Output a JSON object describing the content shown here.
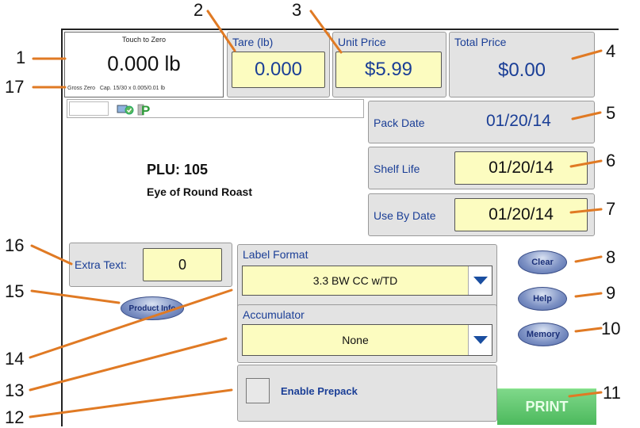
{
  "weight": {
    "caption": "Touch to Zero",
    "value": "0.000 lb",
    "status": "Gross Zero   Cap. 15/30 x 0.005/0.01 lb"
  },
  "tare": {
    "label": "Tare (lb)",
    "value": "0.000"
  },
  "unit_price": {
    "label": "Unit Price",
    "value": "$5.99"
  },
  "total_price": {
    "label": "Total Price",
    "value": "$0.00"
  },
  "pack_date": {
    "label": "Pack Date",
    "value": "01/20/14"
  },
  "shelf_life": {
    "label": "Shelf Life",
    "value": "01/20/14"
  },
  "use_by": {
    "label": "Use By Date",
    "value": "01/20/14"
  },
  "plu": {
    "number": "PLU: 105",
    "description": "Eye of Round Roast"
  },
  "extra_text": {
    "label": "Extra Text:",
    "value": "0"
  },
  "label_format": {
    "title": "Label Format",
    "selected": "3.3 BW CC w/TD"
  },
  "accumulator": {
    "title": "Accumulator",
    "selected": "None"
  },
  "prepack": {
    "label": "Enable Prepack"
  },
  "buttons": {
    "clear": "Clear",
    "help": "Help",
    "memory": "Memory",
    "product_info": "Product Info",
    "print": "PRINT"
  },
  "callouts": [
    "1",
    "2",
    "3",
    "4",
    "5",
    "6",
    "7",
    "8",
    "9",
    "10",
    "11",
    "12",
    "13",
    "14",
    "15",
    "16",
    "17"
  ],
  "colors": {
    "accent_blue": "#1a3e96",
    "field_yellow": "#fcfcc0",
    "callout_orange": "#e07a24",
    "print_green": "#5cc26a"
  }
}
